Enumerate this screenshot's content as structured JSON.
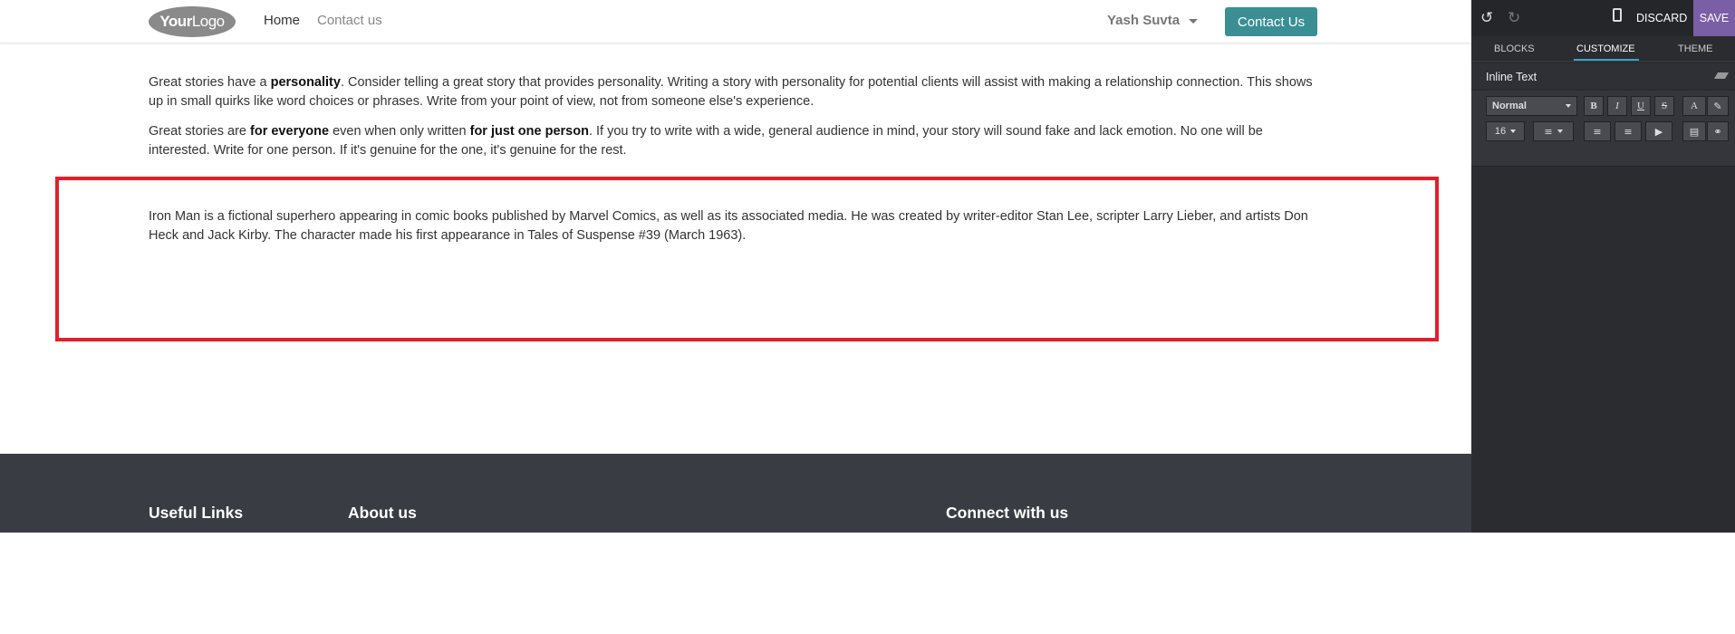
{
  "navbar": {
    "logo_bold": "Your",
    "logo_light": "Logo",
    "links": [
      "Home",
      "Contact us"
    ],
    "user": "Yash Suvta",
    "cta": "Contact Us"
  },
  "content": {
    "para1": {
      "pre": "Great stories have a ",
      "bold": "personality",
      "post": ". Consider telling a great story that provides personality. Writing a story with personality for potential clients will assist with making a relationship connection. This shows up in small quirks like word choices or phrases. Write from your point of view, not from someone else's experience."
    },
    "para2": {
      "pre": "Great stories are ",
      "bold1": "for everyone",
      "mid": " even when only written ",
      "bold2": "for just one person",
      "post": ". If you try to write with a wide, general audience in mind, your story will sound fake and lack emotion. No one will be interested. Write for one person. If it's genuine for the one, it's genuine for the rest."
    },
    "para3": "Iron Man is a fictional superhero appearing in comic books published by Marvel Comics, as well as its associated media. He was created by writer-editor Stan Lee, scripter Larry Lieber, and artists Don Heck and Jack Kirby. The character made his first appearance in Tales of Suspense #39 (March 1963)."
  },
  "footer": {
    "useful_links": "Useful Links",
    "about_us": "About us",
    "connect": "Connect with us"
  },
  "editor": {
    "discard": "DISCARD",
    "save": "SAVE",
    "tabs": [
      "BLOCKS",
      "CUSTOMIZE",
      "THEME"
    ],
    "active_tab": "CUSTOMIZE",
    "section_title": "Inline Text",
    "toolbar": {
      "style": "Normal",
      "bold": "B",
      "italic": "I",
      "underline": "U",
      "strike": "S",
      "font_color": "A",
      "font_size": "16"
    },
    "icons": [
      "undo-icon",
      "redo-icon",
      "mobile-icon",
      "eraser-icon",
      "paint-brush-icon",
      "align-icon",
      "unordered-list-icon",
      "ordered-list-icon",
      "video-icon",
      "file-icon",
      "link-icon"
    ]
  },
  "colors": {
    "accent": "#3a8f94",
    "selection": "#e0202d",
    "save": "#7a5fa6",
    "footer": "#393c43",
    "editor_bg": "#2b2c30"
  }
}
